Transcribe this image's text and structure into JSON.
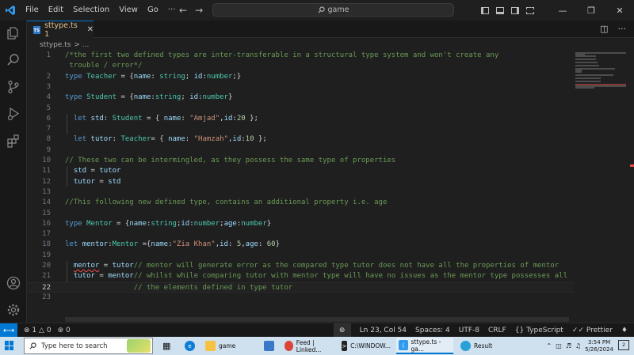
{
  "menu": [
    "File",
    "Edit",
    "Selection",
    "View",
    "Go",
    "···"
  ],
  "search": {
    "text": "game"
  },
  "tab": {
    "label": "sttype.ts 1",
    "badge": "TS"
  },
  "breadcrumb": {
    "file": "sttype.ts",
    "rest": "> ..."
  },
  "code_lines": [
    {
      "n": "1",
      "t": "/*the first two defined types are inter-transferable in a structural type system and won't create any"
    },
    {
      "n": "",
      "t": " trouble / error*/"
    },
    {
      "n": "2",
      "t": "type Teacher = {name: string; id:number;}"
    },
    {
      "n": "3",
      "t": ""
    },
    {
      "n": "4",
      "t": "type Student = {name:string; id:number}"
    },
    {
      "n": "5",
      "t": ""
    },
    {
      "n": "6",
      "t": "  let std: Student = { name: \"Amjad\",id:20 };"
    },
    {
      "n": "7",
      "t": ""
    },
    {
      "n": "8",
      "t": "  let tutor: Teacher= { name: \"Hamzah\",id:10 };"
    },
    {
      "n": "9",
      "t": ""
    },
    {
      "n": "10",
      "t": "// These two can be intermingled, as they possess the same type of properties"
    },
    {
      "n": "11",
      "t": "  std = tutor"
    },
    {
      "n": "12",
      "t": "  tutor = std"
    },
    {
      "n": "13",
      "t": ""
    },
    {
      "n": "14",
      "t": "//This following new defined type, contains an additional property i.e. age"
    },
    {
      "n": "15",
      "t": ""
    },
    {
      "n": "16",
      "t": "type Mentor = {name:string;id:number;age:number}"
    },
    {
      "n": "17",
      "t": ""
    },
    {
      "n": "18",
      "t": "let mentor:Mentor ={name:\"Zia Khan\",id: 5,age: 60}"
    },
    {
      "n": "19",
      "t": ""
    },
    {
      "n": "20",
      "t": "  mentor = tutor// mentor will generate error as the compared type tutor does not have all the properties of mentor"
    },
    {
      "n": "21",
      "t": "  tutor = mentor// whilst while comparing tutor with mentor type will have no issues as the mentor type possesses all"
    },
    {
      "n": "22",
      "t": "                // the elements defined in type tutor"
    },
    {
      "n": "23",
      "t": ""
    }
  ],
  "status": {
    "errors": "1",
    "warnings": "0",
    "ports": "0",
    "position": "Ln 23, Col 54",
    "spaces": "Spaces: 4",
    "encoding": "UTF-8",
    "eol": "CRLF",
    "language": "TypeScript",
    "formatter": "Prettier"
  },
  "taskbar": {
    "search_placeholder": "Type here to search",
    "apps": [
      "game",
      "Feed | Linked...",
      "C:\\WINDOW...",
      "sttype.ts - ga...",
      "Result"
    ],
    "time": "3:54 PM",
    "date": "5/26/2024",
    "notifications": "2"
  }
}
